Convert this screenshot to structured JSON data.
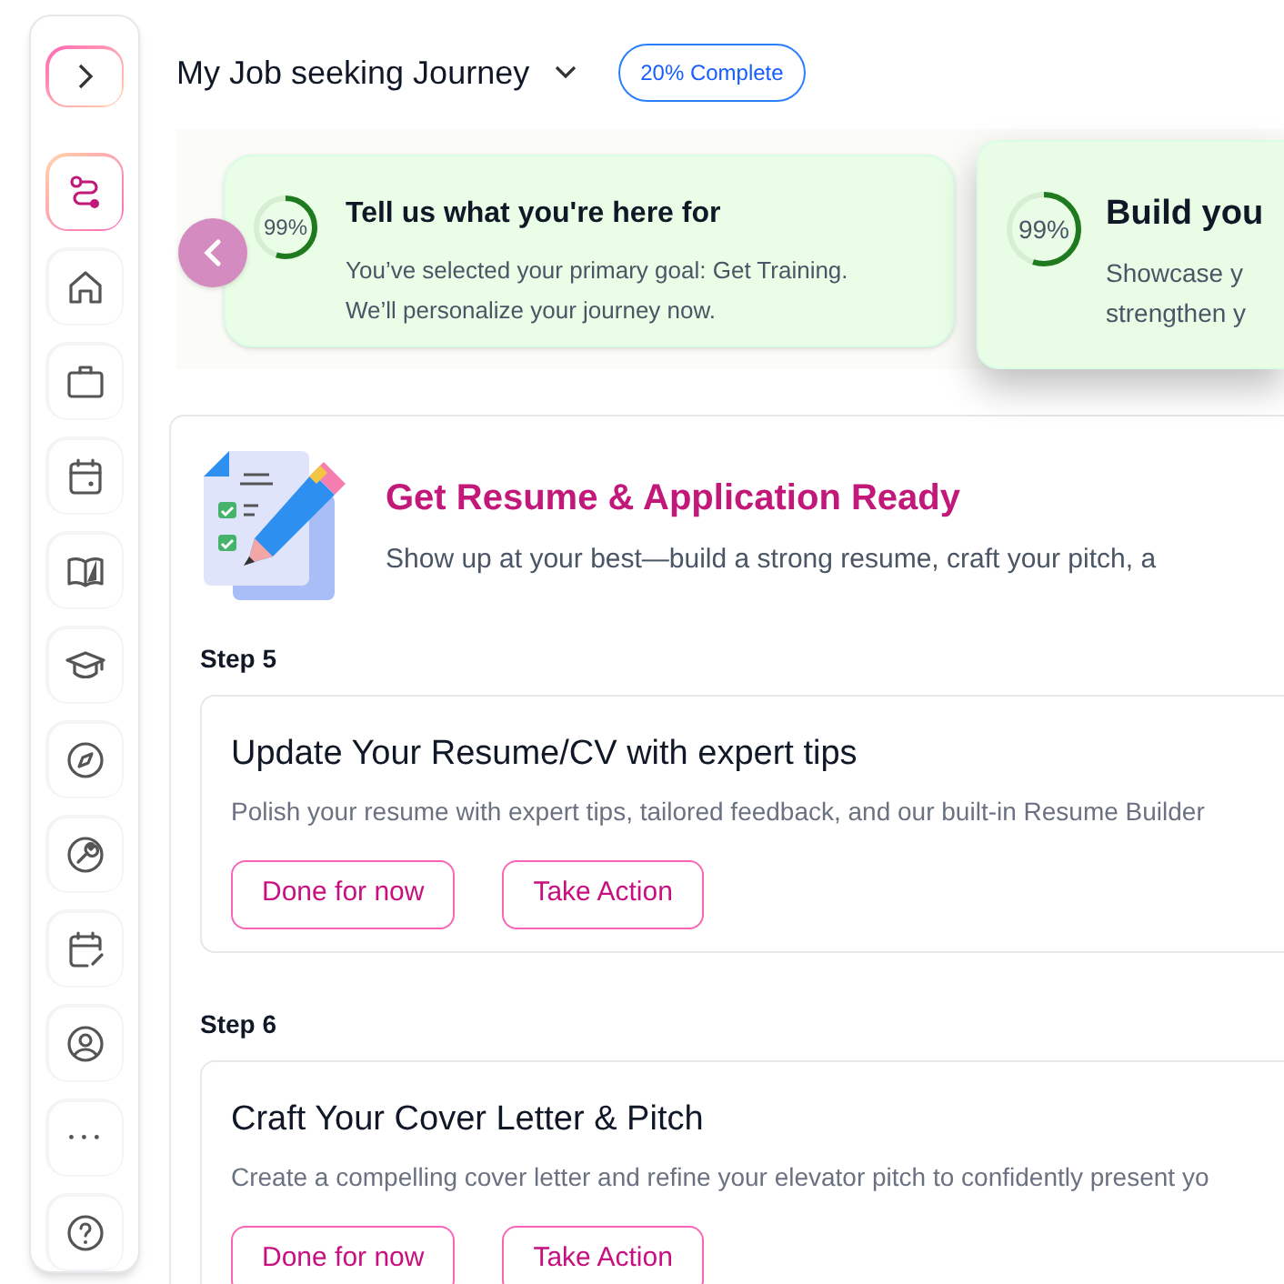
{
  "sidebar": {
    "items": [
      {
        "selected": true
      },
      {
        "selected": false
      },
      {
        "selected": false
      },
      {
        "selected": false
      },
      {
        "selected": false
      },
      {
        "selected": false
      },
      {
        "selected": false
      },
      {
        "selected": false
      },
      {
        "selected": false
      },
      {
        "selected": false
      },
      {
        "selected": false
      },
      {
        "selected": false
      }
    ]
  },
  "header": {
    "title": "My Job seeking Journey",
    "badge": "20% Complete"
  },
  "journey_cards": [
    {
      "title": "Tell us what you're here for",
      "description": "You’ve selected your primary goal: Get Training. We’ll personalize your journey now.",
      "percent": "99%",
      "level": 0.55,
      "focused": false
    },
    {
      "title": "Build you",
      "lines": [
        "Showcase y",
        "strengthen y"
      ],
      "percent": "99%",
      "level": 0.55,
      "focused": true
    }
  ],
  "section": {
    "title": "Get Resume & Application Ready",
    "subtitle": "Show up at your best—build a strong resume, craft your pitch, a",
    "steps": [
      {
        "label": "Step 5",
        "title": "Update Your Resume/CV with expert tips",
        "description": "Polish your resume with expert tips, tailored feedback, and our built-in Resume Builder",
        "buttons": [
          "Done for now",
          "Take Action"
        ]
      },
      {
        "label": "Step 6",
        "title": "Craft Your Cover Letter & Pitch",
        "description": "Create a compelling cover letter and refine your elevator pitch to confidently present yo",
        "buttons": [
          "Done for now",
          "Take Action"
        ]
      }
    ]
  }
}
